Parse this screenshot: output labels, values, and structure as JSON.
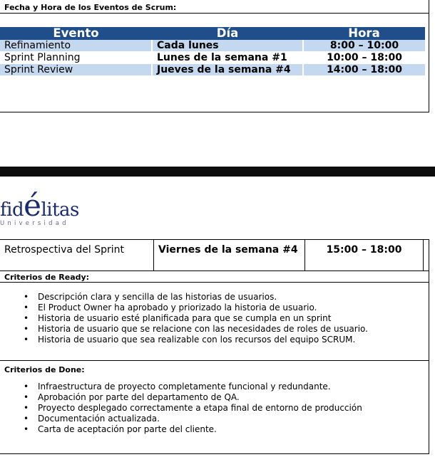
{
  "schedule": {
    "title": "Fecha y Hora de los Eventos de Scrum:",
    "headers": [
      "Evento",
      "Día",
      "Hora"
    ],
    "rows": [
      {
        "event": "Refinamiento",
        "day": "Cada lunes",
        "time": "8:00 – 10:00"
      },
      {
        "event": "Sprint Planning",
        "day": "Lunes de la semana #1",
        "time": "10:00 – 18:00"
      },
      {
        "event": "Sprint Review",
        "day": "Jueves de la semana #4",
        "time": "14:00 – 18:00"
      },
      {
        "event": "Retrospectiva del Sprint",
        "day": "Viernes de la semana #4",
        "time": "15:00 – 18:00"
      }
    ]
  },
  "logo": {
    "word_pre": "fid",
    "word_e": "é",
    "word_post": "litas",
    "sub": "Universidad"
  },
  "ready": {
    "title": "Criterios de Ready:",
    "items": [
      "Descripción clara y sencilla de las historias de usuarios.",
      "El Product Owner ha aprobado y priorizado la historia de usuario.",
      "Historia de usuario esté planificada para que se cumpla en un sprint",
      "Historia de usuario que se relacione con las necesidades de roles de usuario.",
      "Historia de usuario que sea realizable con los recursos del equipo SCRUM."
    ]
  },
  "done": {
    "title": "Criterios de Done:",
    "items": [
      "Infraestructura de proyecto completamente funcional y redundante.",
      "Aprobación por parte del departamento de QA.",
      "Proyecto desplegado correctamente a etapa final de entorno de producción",
      "Documentación actualizada.",
      "Carta de aceptación por parte del cliente."
    ]
  }
}
